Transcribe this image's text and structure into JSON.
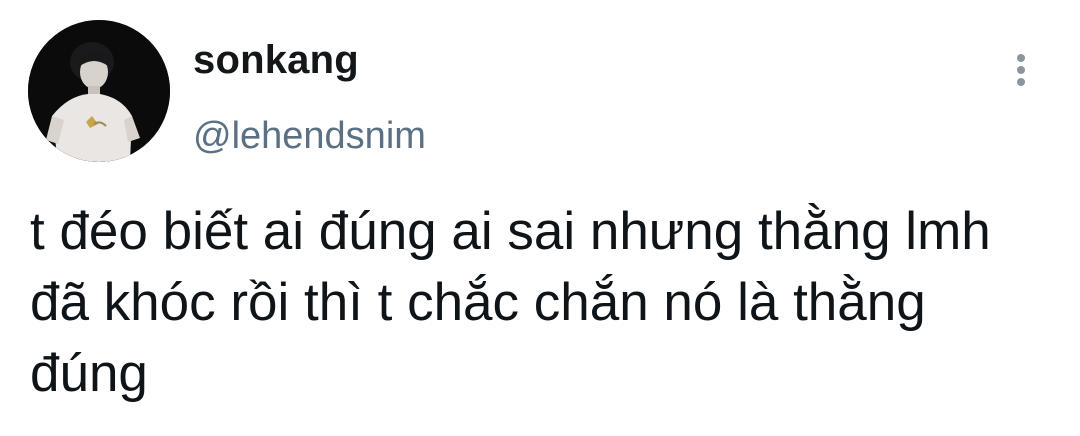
{
  "author": {
    "display_name": "sonkang",
    "handle": "@lehendsnim"
  },
  "tweet": {
    "text": "t đéo biết ai đúng ai sai nhưng thằng lmh đã khóc rồi thì t chắc chắn nó là thằng đúng"
  },
  "icons": {
    "more": "more-vertical-icon"
  },
  "colors": {
    "name": "#14171a",
    "handle": "#5b7083",
    "text": "#0f1419",
    "avatar_bg": "#0b0b0c"
  }
}
